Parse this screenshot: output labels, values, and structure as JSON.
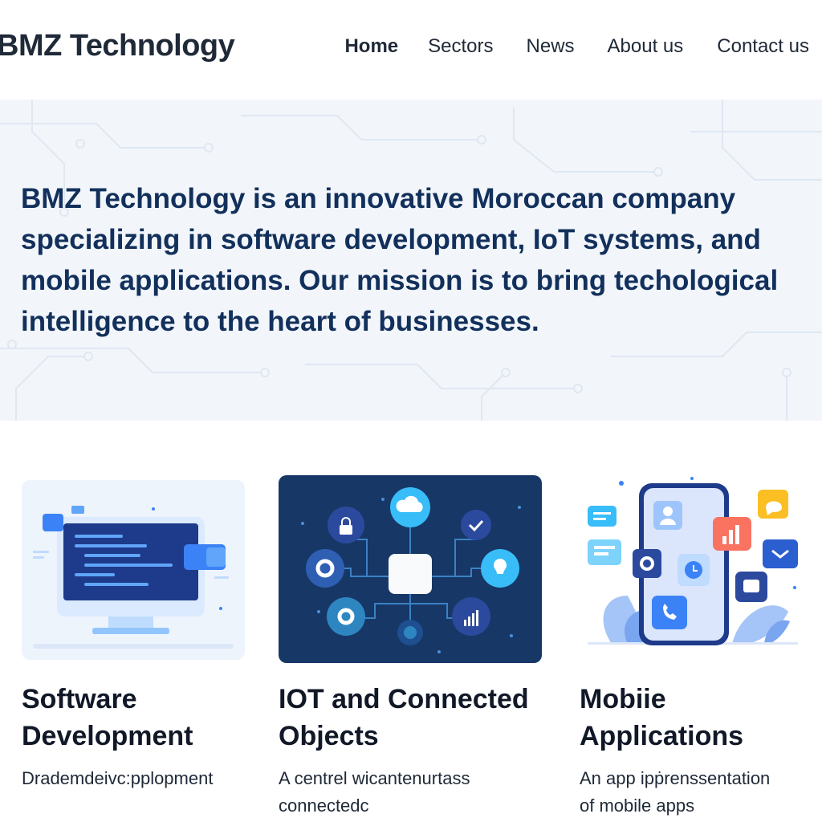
{
  "header": {
    "logo": "BMZ Technology",
    "nav": [
      {
        "label": "Home",
        "active": true
      },
      {
        "label": "Sectors",
        "active": false
      },
      {
        "label": "News",
        "active": false
      },
      {
        "label": "About us",
        "active": false
      },
      {
        "label": "Contact us",
        "active": false
      }
    ]
  },
  "hero": {
    "text": "BMZ Technology is an innovative Moroccan company specializing in software development, IoT systems,  and mobile applications. Our mission is to bring techological intelligence to the heart of businesses."
  },
  "cards": [
    {
      "title_line1": "Software",
      "title_line2": "Development",
      "desc_line1": "Drademdeivc:pplopment",
      "desc_line2": "",
      "image": "code-monitor-illustration"
    },
    {
      "title_line1": "IOT and Connected",
      "title_line2": "Objects",
      "desc_line1": "A centrel wicantenurtass",
      "desc_line2": "connectedc",
      "image": "iot-network-illustration"
    },
    {
      "title_line1": "Mobiie",
      "title_line2": "Applications",
      "desc_line1": "An app ipṗrenssentation",
      "desc_line2": "of mobile apps",
      "image": "mobile-apps-illustration"
    }
  ],
  "colors": {
    "hero_bg": "#f2f6fb",
    "hero_text": "#12305b",
    "iot_card_bg": "#173766",
    "accent_blue": "#3b82f6"
  }
}
